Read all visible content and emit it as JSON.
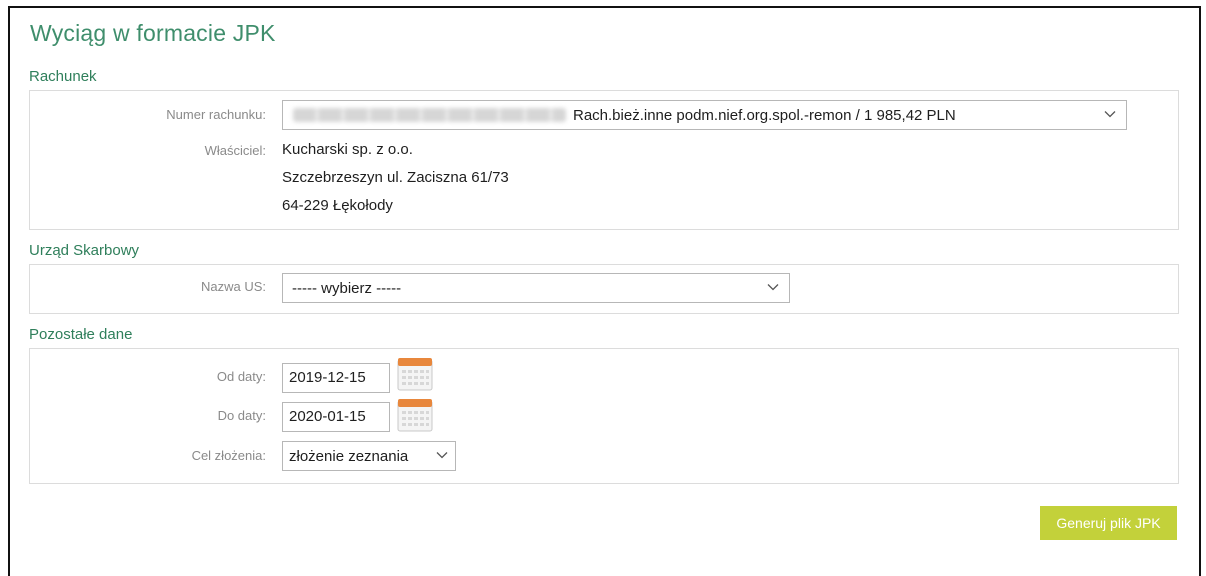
{
  "page": {
    "title": "Wyciąg w formacie JPK"
  },
  "sections": {
    "account": "Rachunek",
    "tax_office": "Urząd Skarbowy",
    "other": "Pozostałe dane"
  },
  "account": {
    "number_label": "Numer rachunku:",
    "number_text": "Rach.bież.inne podm.nief.org.spol.-remon / 1 985,42 PLN",
    "owner_label": "Właściciel:",
    "owner_lines": [
      "Kucharski sp. z o.o.",
      "Szczebrzeszyn ul. Zaciszna 61/73",
      "64-229 Łękołody"
    ]
  },
  "tax_office": {
    "label": "Nazwa US:",
    "selected": "----- wybierz -----"
  },
  "other": {
    "from_label": "Od daty:",
    "from_value": "2019-12-15",
    "to_label": "Do daty:",
    "to_value": "2020-01-15",
    "purpose_label": "Cel złożenia:",
    "purpose_selected": "złożenie zeznania"
  },
  "actions": {
    "generate_label": "Generuj plik JPK"
  },
  "icons": {
    "dropdown": "chevron-down-icon",
    "calendar": "calendar-icon"
  },
  "colors": {
    "title": "#3f8e6c",
    "section": "#2f7f5b",
    "button": "#c3d13a"
  }
}
